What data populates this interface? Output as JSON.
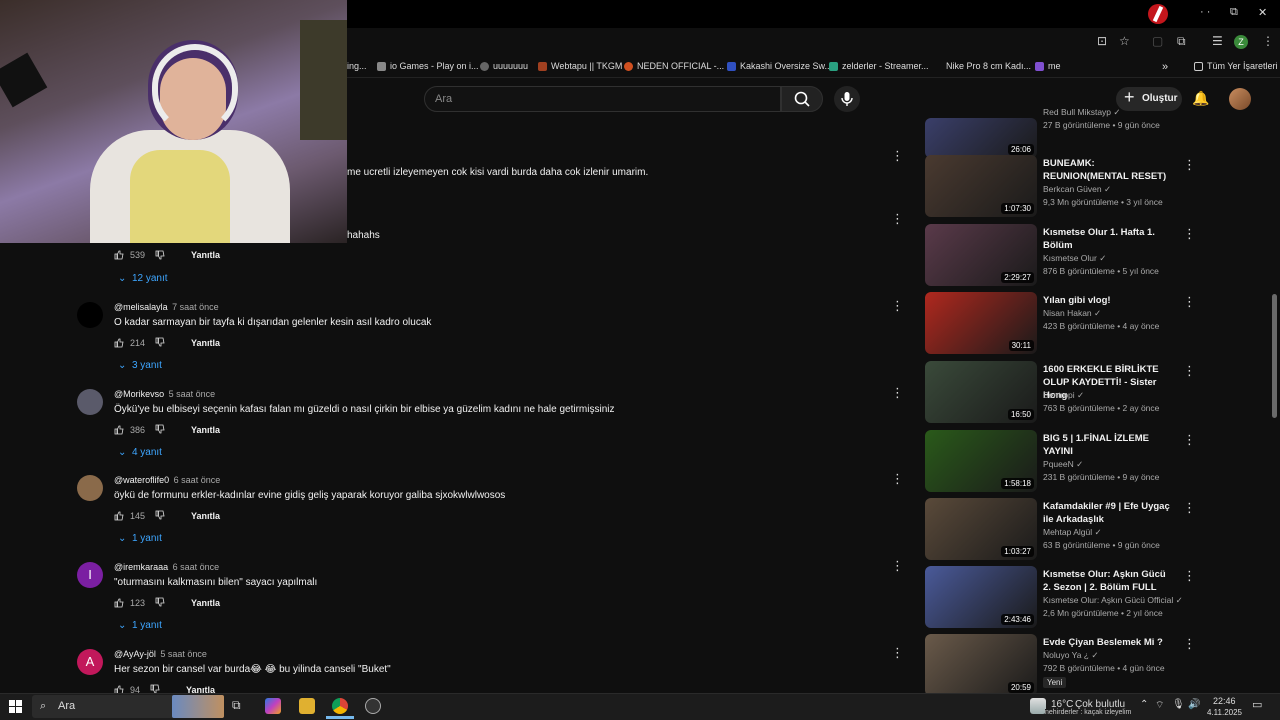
{
  "browser": {
    "bookmarks": [
      {
        "label": "ing..."
      },
      {
        "label": "io Games - Play on i..."
      },
      {
        "label": "uuuuuuu"
      },
      {
        "label": "Webtapu || TKGM"
      },
      {
        "label": "NEDEN OFFICIAL -..."
      },
      {
        "label": "Kakashi Oversize Sw..."
      },
      {
        "label": "zelderler - Streamer..."
      },
      {
        "label": "Nike Pro 8 cm Kadı..."
      },
      {
        "label": "me"
      },
      {
        "label": "»"
      },
      {
        "label": "Tüm Yer İşaretleri"
      }
    ],
    "profile_initial": "Z"
  },
  "youtube": {
    "search_placeholder": "Ara",
    "create_label": "Oluştur"
  },
  "comments_partial": [
    {
      "text": "me ucretli izleyemeyen cok kisi vardi burda daha cok izlenir umarim."
    },
    {
      "text": "hahahs"
    }
  ],
  "first_actions": {
    "likes": "539",
    "reply": "Yanıtla",
    "replies": "12 yanıt"
  },
  "comments": [
    {
      "author": "@melisalayla",
      "time": "7 saat önce",
      "text": "O kadar sarmayan bir tayfa ki dışarıdan gelenler kesin asıl kadro olucak",
      "likes": "214",
      "reply": "Yanıtla",
      "replies": "3 yanıt",
      "avatar_color": "#000000",
      "avatar_letter": ""
    },
    {
      "author": "@Morikevso",
      "time": "5 saat önce",
      "text": "Öykü'ye bu elbiseyi seçenin kafası falan mı güzeldi o nasıl çirkin bir elbise ya güzelim kadını ne hale getirmişsiniz",
      "likes": "386",
      "reply": "Yanıtla",
      "replies": "4 yanıt",
      "avatar_color": "#5a5a6a",
      "avatar_letter": ""
    },
    {
      "author": "@wateroflife0",
      "time": "6 saat önce",
      "text": "öykü de formunu erkler-kadınlar evine gidiş geliş yaparak koruyor galiba sjxokwlwlwosos",
      "likes": "145",
      "reply": "Yanıtla",
      "replies": "1 yanıt",
      "avatar_color": "#8a6a4a",
      "avatar_letter": ""
    },
    {
      "author": "@iremkaraaa",
      "time": "6 saat önce",
      "text": "\"oturmasını kalkmasını bilen\" sayacı yapılmalı",
      "likes": "123",
      "reply": "Yanıtla",
      "replies": "1 yanıt",
      "avatar_color": "#7b1fa2",
      "avatar_letter": "I"
    },
    {
      "author": "@AyAy-jöl",
      "time": "5 saat önce",
      "text": "Her sezon bir cansel var burda😂 😂 bu yilinda canseli \"Buket\"",
      "likes": "94",
      "reply": "Yanıtla",
      "replies": "",
      "avatar_color": "#c2185b",
      "avatar_letter": "A"
    }
  ],
  "videos": [
    {
      "title": "",
      "channel": "Red Bull Mikstayp",
      "stats": "27 B görüntüleme • 9 gün önce",
      "duration": "26:06",
      "thumb_color": "#3a3f6a"
    },
    {
      "title": "BUNEAMK: REUNION(MENTAL RESET)",
      "channel": "Berkcan Güven",
      "stats": "9,3 Mn görüntüleme • 3 yıl önce",
      "duration": "1:07:30",
      "thumb_color": "#4a3a30"
    },
    {
      "title": "Kısmetse Olur 1. Hafta 1. Bölüm",
      "channel": "Kısmetse Olur",
      "stats": "876 B görüntüleme • 5 yıl önce",
      "duration": "2:29:27",
      "thumb_color": "#5a3a4a"
    },
    {
      "title": "Yılan gibi vlog!",
      "channel": "Nisan Hakan",
      "stats": "423 B görüntüleme • 4 ay önce",
      "duration": "30:11",
      "thumb_color": "#b0281e"
    },
    {
      "title": "1600 ERKEKLE BİRLİKTE OLUP KAYDETTİ! - Sister Hong",
      "channel": "Bentropi",
      "stats": "763 B görüntüleme • 2 ay önce",
      "duration": "16:50",
      "thumb_color": "#3a4a3a"
    },
    {
      "title": "BIG 5 | 1.FİNAL İZLEME YAYINI",
      "channel": "PqueeN",
      "stats": "231 B görüntüleme • 9 ay önce",
      "duration": "1:58:18",
      "thumb_color": "#2a5a1a"
    },
    {
      "title": "Kafamdakiler #9 | Efe Uygaç ile Arkadaşlık",
      "channel": "Mehtap Algül",
      "stats": "63 B görüntüleme • 9 gün önce",
      "duration": "1:03:27",
      "thumb_color": "#5a4a3a"
    },
    {
      "title": "Kısmetse Olur: Aşkın Gücü 2. Sezon | 2. Bölüm FULL",
      "channel": "Kısmetse Olur: Aşkın Gücü Official",
      "stats": "2,6 Mn görüntüleme • 2 yıl önce",
      "duration": "2:43:46",
      "thumb_color": "#4a5a9a"
    },
    {
      "title": "Evde Çiyan Beslemek Mi ?",
      "channel": "Noluyo Ya ¿",
      "stats": "792 B görüntüleme • 4 gün önce",
      "duration": "20:59",
      "badge": "Yeni",
      "thumb_color": "#6a5a4a"
    }
  ],
  "taskbar": {
    "search_placeholder": "Ara",
    "weather_temp": "16°C",
    "weather_desc": "Çok bulutlu",
    "notification": "nehirderler : kaçak izleyelim",
    "time": "22:46",
    "date": "4.11.2025"
  }
}
